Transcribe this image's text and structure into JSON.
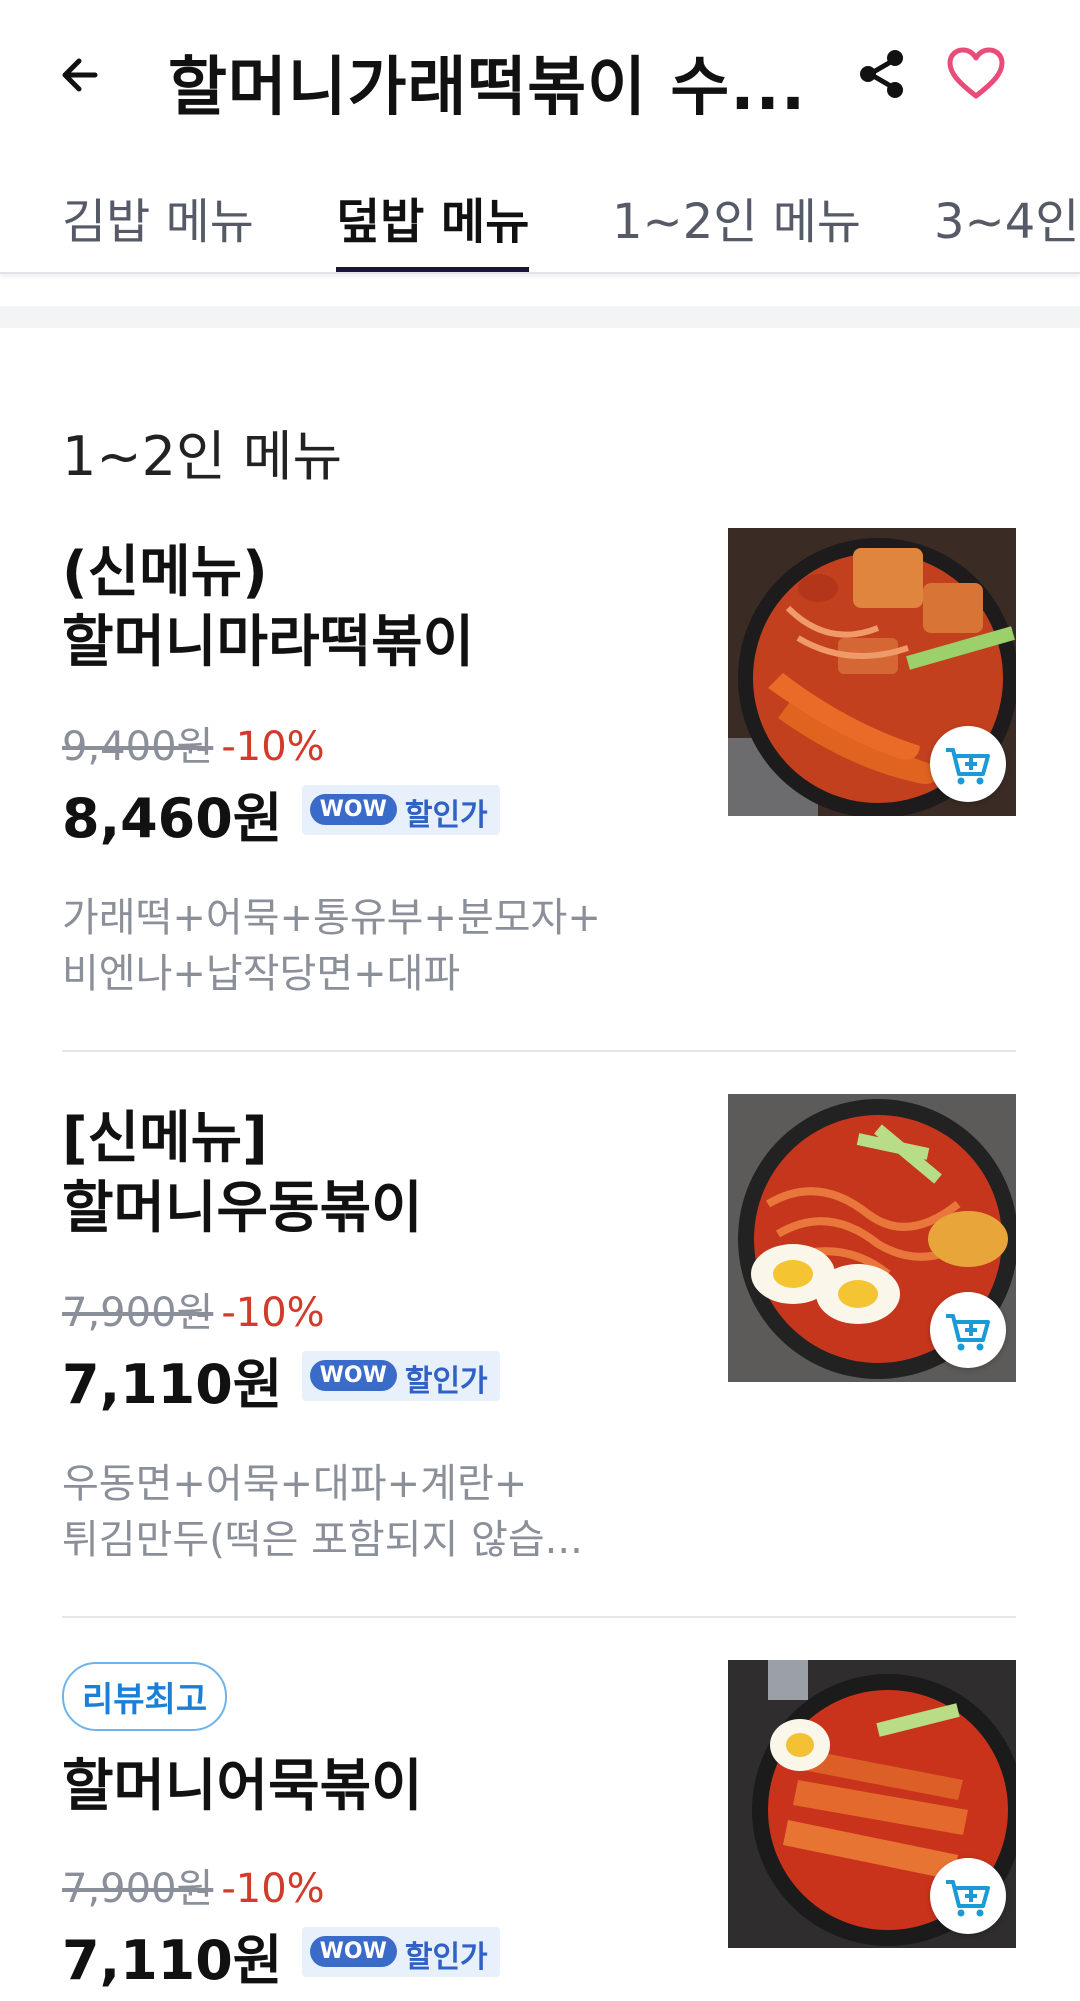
{
  "header": {
    "title": "할머니가래떡볶이 수...",
    "back_icon": "back-arrow-icon",
    "share_icon": "share-icon",
    "favorite_icon": "heart-icon",
    "favorite_color": "#e94b7a"
  },
  "tabs": [
    {
      "label": "김밥 메뉴",
      "active": false
    },
    {
      "label": "덮밥 메뉴",
      "active": true
    },
    {
      "label": "1~2인 메뉴",
      "active": false
    },
    {
      "label": "3~4인",
      "active": false
    }
  ],
  "section": {
    "title": "1~2인 메뉴"
  },
  "items": [
    {
      "name_line1": "(신메뉴)",
      "name_line2": "할머니마라떡볶이",
      "original_price": "9,400원",
      "discount": "-10%",
      "price": "8,460원",
      "wow_pill": "WOW",
      "wow_text": "할인가",
      "desc_line1": "가래떡+어묵+통유부+분모자+",
      "desc_line2": "비엔나+납작당면+대파"
    },
    {
      "name_line1": "[신메뉴]",
      "name_line2": "할머니우동볶이",
      "original_price": "7,900원",
      "discount": "-10%",
      "price": "7,110원",
      "wow_pill": "WOW",
      "wow_text": "할인가",
      "desc_line1": "우동면+어묵+대파+계란+",
      "desc_line2": "튀김만두(떡은 포함되지 않습..."
    },
    {
      "badge": "리뷰최고",
      "name_line1": "할머니어묵볶이",
      "original_price": "7,900원",
      "discount": "-10%",
      "price": "7,110원",
      "wow_pill": "WOW",
      "wow_text": "할인가"
    }
  ],
  "colors": {
    "accent_tab_underline": "#1b1539",
    "discount_red": "#d23a2c",
    "wow_blue": "#3a6bc9",
    "review_badge_blue": "#1a7fd6"
  }
}
